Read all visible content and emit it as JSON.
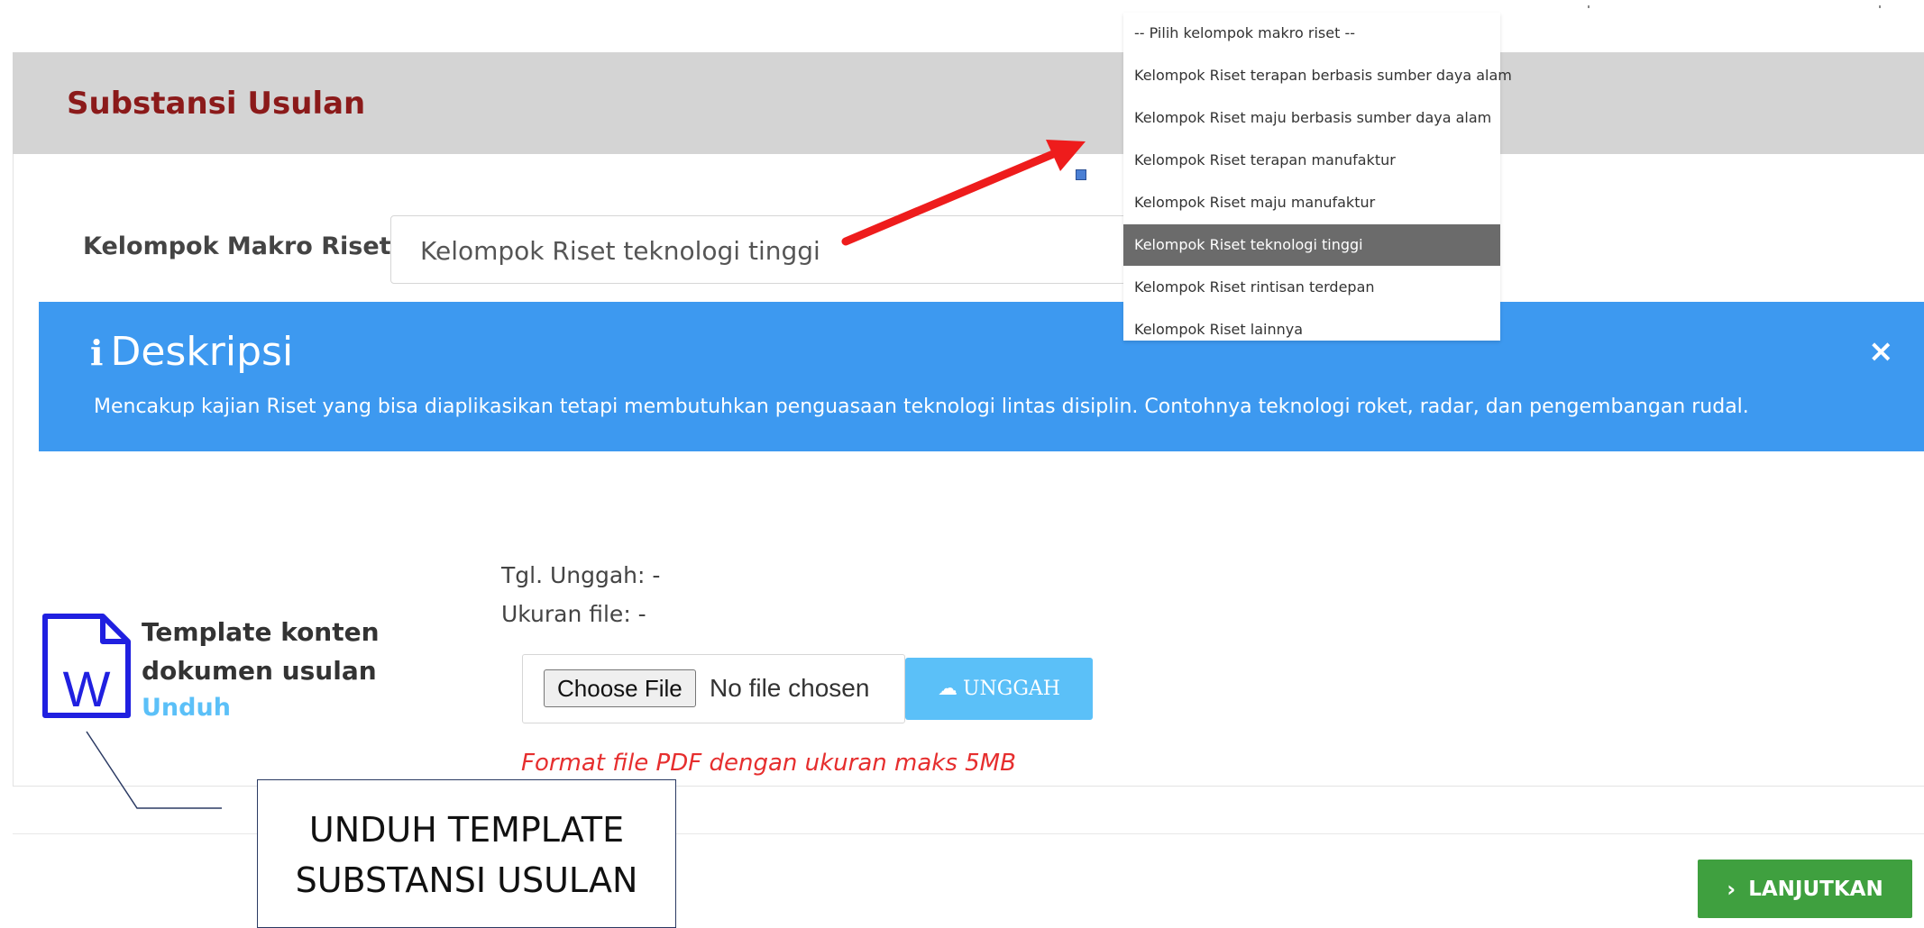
{
  "panel": {
    "title": "Substansi Usulan"
  },
  "kelompok": {
    "label": "Kelompok Makro Riset",
    "selected": "Kelompok Riset teknologi tinggi"
  },
  "dropdown": {
    "options": [
      "-- Pilih kelompok makro riset --",
      "Kelompok Riset terapan berbasis sumber daya alam",
      "Kelompok Riset maju berbasis sumber daya alam",
      "Kelompok Riset terapan manufaktur",
      "Kelompok Riset maju manufaktur",
      "Kelompok Riset teknologi tinggi",
      "Kelompok Riset rintisan terdepan",
      "Kelompok Riset lainnya"
    ],
    "selected_index": 5
  },
  "alert": {
    "icon": "i",
    "title": "Deskripsi",
    "close": "×",
    "text": "Mencakup kajian Riset yang bisa diaplikasikan tetapi membutuhkan penguasaan teknologi lintas disiplin. Contohnya teknologi roket, radar, dan pengembangan rudal."
  },
  "template": {
    "icon_letter": "W",
    "title": "Template konten dokumen usulan",
    "link": "Unduh"
  },
  "upload": {
    "tgl": "Tgl. Unggah: -",
    "ukuran": "Ukuran file: -",
    "choose_label": "Choose File",
    "no_file": "No file chosen",
    "button_label": "UNGGAH",
    "hint": "Format file PDF dengan ukuran maks 5MB"
  },
  "annotation": {
    "line1": "UNDUH TEMPLATE",
    "line2": "SUBSTANSI USULAN"
  },
  "next": {
    "label": "LANJUTKAN",
    "chevron": "›"
  },
  "colors": {
    "panel_title": "#8b1a1a",
    "alert_bg": "#3d99f0",
    "upload_btn": "#5bc0f8",
    "next_btn": "#3fa03f",
    "hint": "#e62e2e",
    "arrow": "#ee1c1c",
    "word_icon": "#2020e0"
  },
  "icons": {
    "alert": "info-icon",
    "close": "close-icon",
    "template": "word-document-icon",
    "upload": "cloud-upload-icon",
    "next": "chevron-right-icon"
  }
}
